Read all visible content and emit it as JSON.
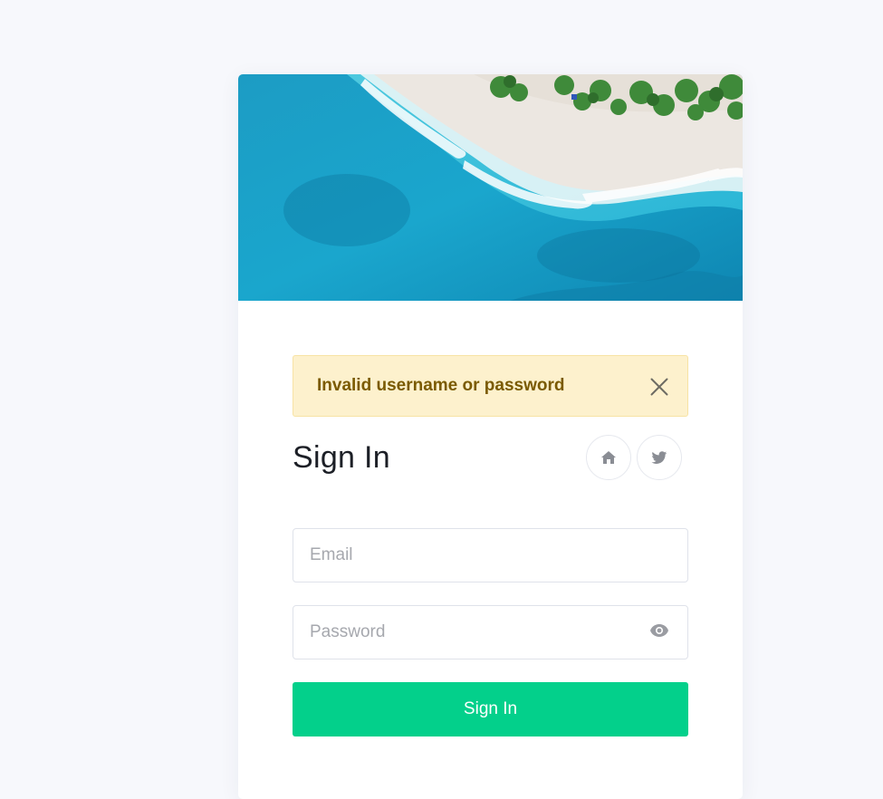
{
  "alert": {
    "message": "Invalid username or password",
    "close_icon": "close-icon"
  },
  "form": {
    "title": "Sign In",
    "email_placeholder": "Email",
    "password_placeholder": "Password",
    "submit_label": "Sign In"
  },
  "social": [
    {
      "icon": "home-icon"
    },
    {
      "icon": "twitter-icon"
    }
  ],
  "colors": {
    "page_background": "#f7f8fc",
    "alert_background": "#fdf1cd",
    "alert_text": "#7a5a00",
    "primary_button": "#03d08b",
    "ocean": "#1a9fc4",
    "sand": "#ece7e1"
  }
}
